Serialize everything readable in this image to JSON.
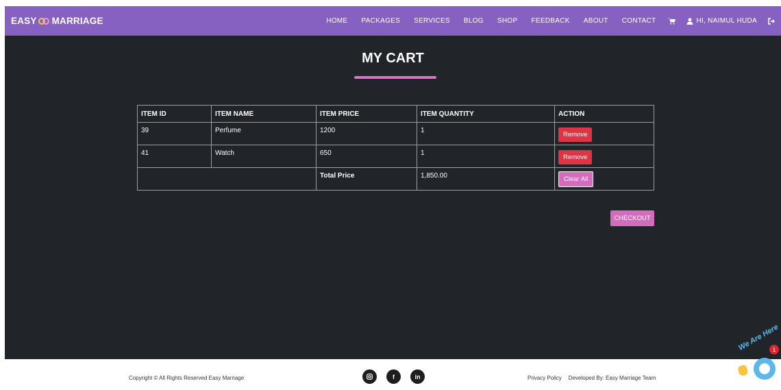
{
  "brand": {
    "part1": "EASY",
    "part2": "MARRIAGE"
  },
  "nav": {
    "links": [
      "HOME",
      "PACKAGES",
      "SERVICES",
      "BLOG",
      "SHOP",
      "FEEDBACK",
      "ABOUT",
      "CONTACT"
    ],
    "user_label": "HI, NAIMUL HUDA",
    "cart_icon": "cart-icon",
    "user_icon": "user-icon",
    "logout_icon": "sign-out-icon"
  },
  "page": {
    "title": "MY CART"
  },
  "cart": {
    "headers": [
      "ITEM ID",
      "ITEM NAME",
      "ITEM PRICE",
      "ITEM QUANTITY",
      "ACTION"
    ],
    "rows": [
      {
        "id": "39",
        "name": "Perfume",
        "price": "1200",
        "quantity": "1",
        "action": "Remove"
      },
      {
        "id": "41",
        "name": "Watch",
        "price": "650",
        "quantity": "1",
        "action": "Remove"
      }
    ],
    "total_label": "Total Price",
    "total_value": "1,850.00",
    "clear_label": "Clear All",
    "checkout_label": "CHECKOUT"
  },
  "footer": {
    "copyright": "Copyright © All Rights Reserved Easy Marriage",
    "socials": [
      "instagram-icon",
      "facebook-icon",
      "linkedin-icon"
    ],
    "privacy": "Privacy Policy",
    "developed": "Developed By: Easy Marriage Team"
  },
  "chat": {
    "text": "We Are Here",
    "badge": "1"
  },
  "colors": {
    "navbar": "#8661c1",
    "background": "#212529",
    "accent": "#d46cbd",
    "danger": "#dc3545"
  }
}
